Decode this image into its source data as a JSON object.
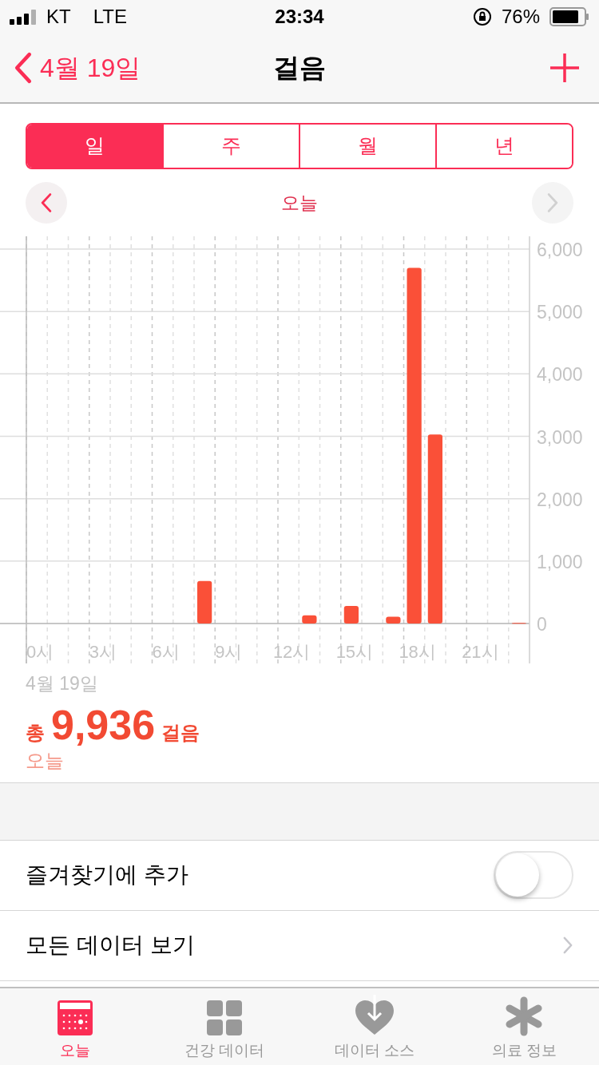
{
  "status_bar": {
    "carrier": "KT",
    "network": "LTE",
    "time": "23:34",
    "battery": "76%"
  },
  "nav": {
    "back": "4월 19일",
    "title": "걸음"
  },
  "segments": [
    {
      "label": "일",
      "selected": true
    },
    {
      "label": "주",
      "selected": false
    },
    {
      "label": "월",
      "selected": false
    },
    {
      "label": "년",
      "selected": false
    }
  ],
  "period": {
    "label": "오늘",
    "prev_disabled": false,
    "next_disabled": true
  },
  "chart_data": {
    "type": "bar",
    "x": [
      8,
      13,
      15,
      17,
      18,
      19,
      23
    ],
    "values": [
      680,
      130,
      280,
      110,
      5700,
      3030,
      10
    ],
    "xlim": [
      -0.5,
      23.5
    ],
    "ylim": [
      0,
      6000
    ],
    "grid": true,
    "yticks": [
      {
        "value": 0,
        "label": "0"
      },
      {
        "value": 1000,
        "label": "1,000"
      },
      {
        "value": 2000,
        "label": "2,000"
      },
      {
        "value": 3000,
        "label": "3,000"
      },
      {
        "value": 4000,
        "label": "4,000"
      },
      {
        "value": 5000,
        "label": "5,000"
      },
      {
        "value": 6000,
        "label": "6,000"
      }
    ],
    "xticks": [
      {
        "value": 0,
        "label": "0시"
      },
      {
        "value": 3,
        "label": "3시"
      },
      {
        "value": 6,
        "label": "6시"
      },
      {
        "value": 9,
        "label": "9시"
      },
      {
        "value": 12,
        "label": "12시"
      },
      {
        "value": 15,
        "label": "15시"
      },
      {
        "value": 18,
        "label": "18시"
      },
      {
        "value": 21,
        "label": "21시"
      }
    ]
  },
  "summary": {
    "date": "4월 19일",
    "prefix": "총",
    "total": "9,936",
    "unit": "걸음",
    "period": "오늘"
  },
  "rows": [
    {
      "kind": "toggle",
      "label": "즐겨찾기에 추가",
      "on": false
    },
    {
      "kind": "link",
      "label": "모든 데이터 보기"
    }
  ],
  "tab_bar": [
    {
      "label": "오늘",
      "selected": true
    },
    {
      "label": "건강 데이터",
      "selected": false
    },
    {
      "label": "데이터 소스",
      "selected": false
    },
    {
      "label": "의료 정보",
      "selected": false
    }
  ]
}
